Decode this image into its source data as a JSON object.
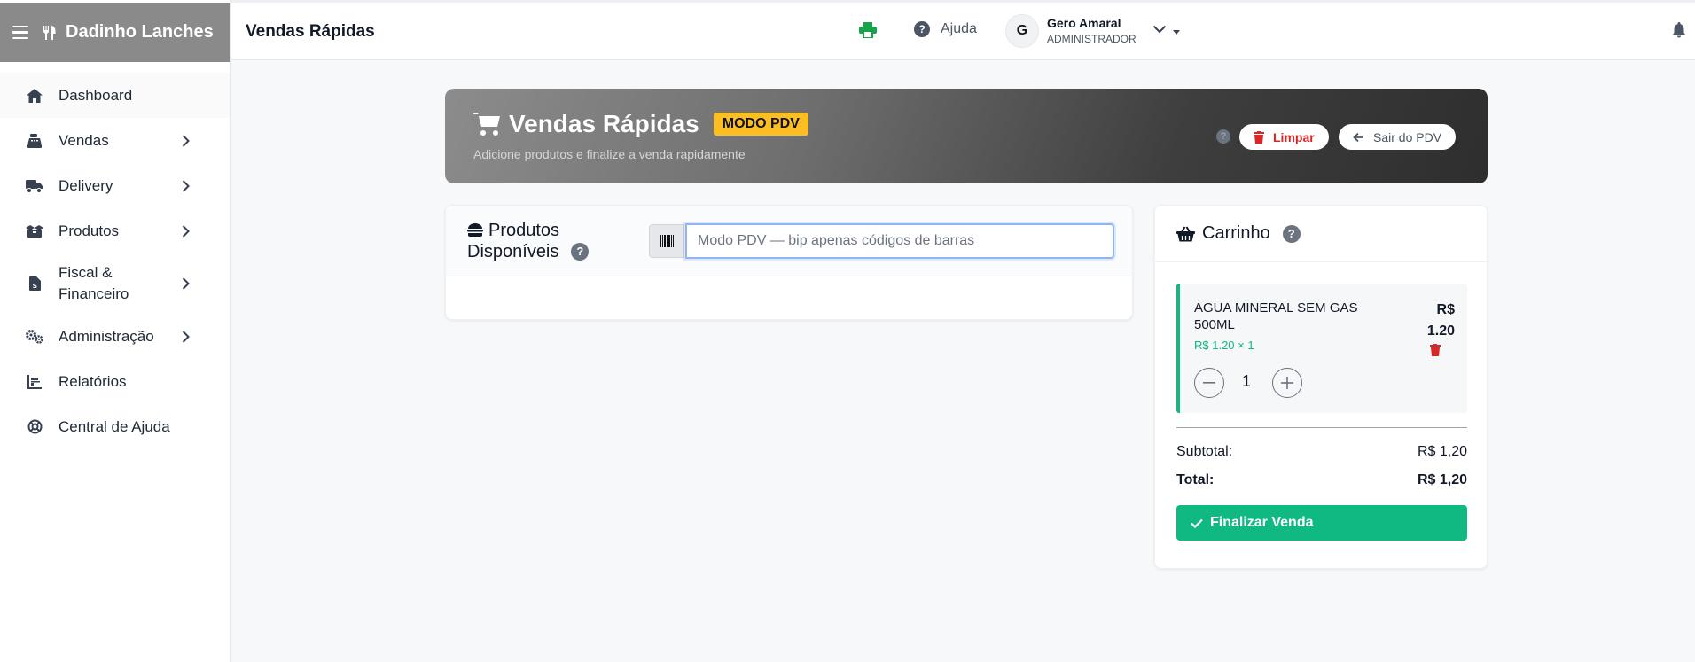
{
  "brand": {
    "name": "Dadinho Lanches"
  },
  "topbar": {
    "title": "Vendas Rápidas",
    "help_label": "Ajuda",
    "avatar_initial": "G",
    "user_name": "Gero Amaral",
    "user_role": "ADMINISTRADOR"
  },
  "sidebar": {
    "items": [
      {
        "label": "Dashboard",
        "icon": "home-icon"
      },
      {
        "label": "Vendas",
        "icon": "cash-register-icon"
      },
      {
        "label": "Delivery",
        "icon": "truck-icon"
      },
      {
        "label": "Produtos",
        "icon": "boxes-icon"
      },
      {
        "label": "Fiscal & Financeiro",
        "icon": "invoice-icon"
      },
      {
        "label": "Administração",
        "icon": "gears-icon"
      },
      {
        "label": "Relatórios",
        "icon": "bar-chart-icon"
      },
      {
        "label": "Central de Ajuda",
        "icon": "lifebuoy-icon"
      }
    ]
  },
  "hero": {
    "title": "Vendas Rápidas",
    "badge": "MODO PDV",
    "subtitle": "Adicione produtos e finalize a venda rapidamente",
    "help_mark": "?",
    "clear_label": "Limpar",
    "exit_label": "Sair do PDV"
  },
  "products": {
    "title_line1": "Produtos",
    "title_line2": "Disponíveis",
    "help_mark": "?",
    "search_placeholder": "Modo PDV — bip apenas códigos de barras",
    "search_value": ""
  },
  "cart": {
    "title": "Carrinho",
    "help_mark": "?",
    "items": [
      {
        "name": "AGUA MINERAL SEM GAS 500ML",
        "unit_line": "R$ 1.20 × 1",
        "price_currency": "R$",
        "price_value": "1.20",
        "quantity": "1"
      }
    ],
    "subtotal_label": "Subtotal:",
    "subtotal_value": "R$ 1,20",
    "total_label": "Total:",
    "total_value": "R$ 1,20",
    "finalize_label": "Finalizar Venda"
  },
  "colors": {
    "accent_green": "#10b981",
    "danger_red": "#dc2626",
    "badge_yellow": "#fbbf24",
    "print_green": "#16a34a"
  }
}
